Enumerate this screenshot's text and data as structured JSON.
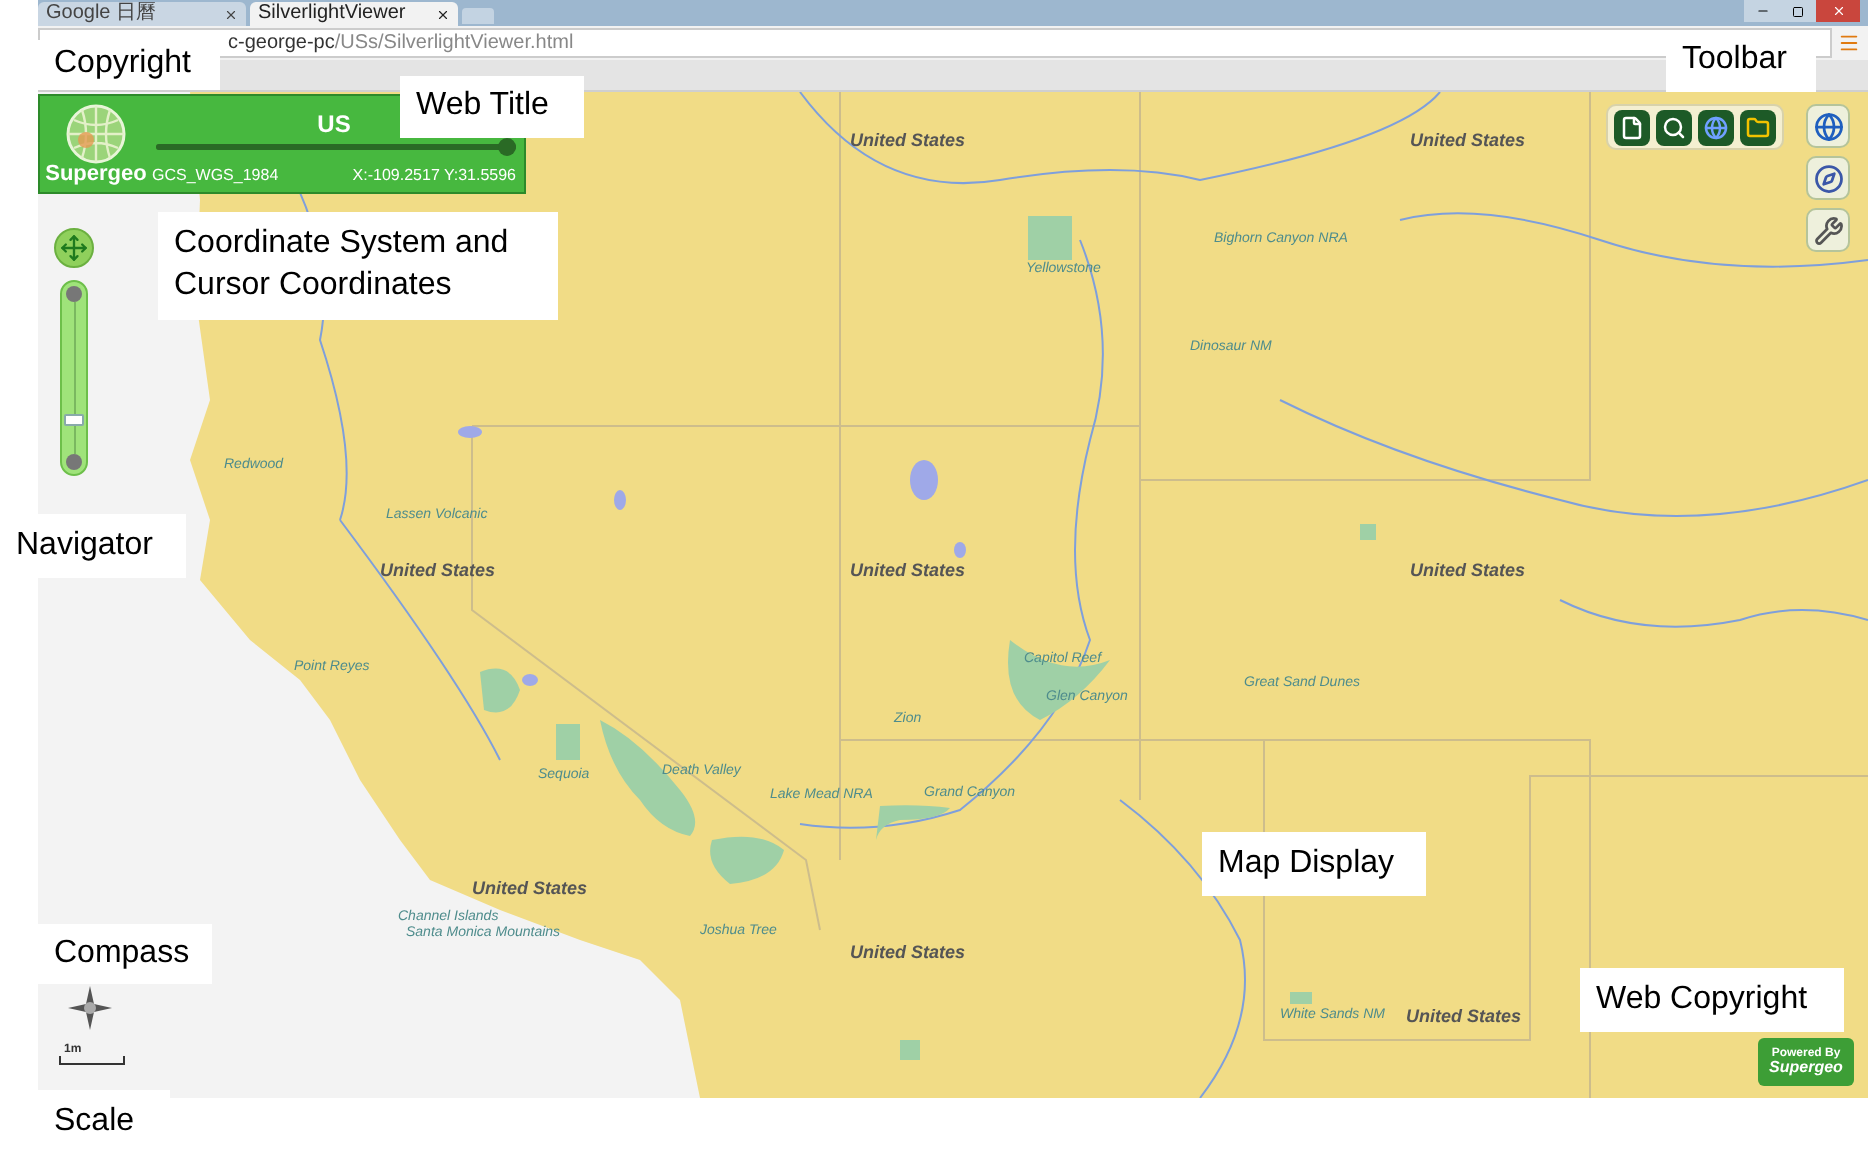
{
  "browser": {
    "tabs": [
      {
        "label": "Google 日曆",
        "selected": false
      },
      {
        "label": "SilverlightViewer",
        "selected": true
      }
    ],
    "address": {
      "host": "c-george-pc",
      "path": "/USs/SilverlightViewer.html"
    }
  },
  "title_panel": {
    "brand": "Supergeo",
    "title": "US",
    "coordinate_system": "GCS_WGS_1984",
    "cursor_coordinates": "X:-109.2517 Y:31.5596",
    "level": 1
  },
  "navigator": {
    "level": 0.2
  },
  "map_labels": [
    {
      "text": "United States",
      "kind": "region"
    },
    {
      "text": "United States",
      "kind": "region"
    },
    {
      "text": "United States",
      "kind": "region"
    },
    {
      "text": "United States",
      "kind": "region"
    },
    {
      "text": "United States",
      "kind": "region"
    },
    {
      "text": "United States",
      "kind": "region"
    },
    {
      "text": "United States",
      "kind": "region"
    },
    {
      "text": "United States",
      "kind": "region"
    },
    {
      "text": "Yellowstone",
      "kind": "park"
    },
    {
      "text": "Bighorn Canyon NRA",
      "kind": "park"
    },
    {
      "text": "Dinosaur NM",
      "kind": "park"
    },
    {
      "text": "Redwood",
      "kind": "park"
    },
    {
      "text": "Lassen Volcanic",
      "kind": "park"
    },
    {
      "text": "Point Reyes",
      "kind": "park"
    },
    {
      "text": "Capitol Reef",
      "kind": "park"
    },
    {
      "text": "Glen Canyon",
      "kind": "park"
    },
    {
      "text": "Great Sand Dunes",
      "kind": "park"
    },
    {
      "text": "Zion",
      "kind": "park"
    },
    {
      "text": "Sequoia",
      "kind": "park"
    },
    {
      "text": "Death Valley",
      "kind": "park"
    },
    {
      "text": "Lake Mead NRA",
      "kind": "park"
    },
    {
      "text": "Grand Canyon",
      "kind": "park"
    },
    {
      "text": "Channel Islands",
      "kind": "park"
    },
    {
      "text": "Santa Monica Mountains",
      "kind": "park"
    },
    {
      "text": "Joshua Tree",
      "kind": "park"
    },
    {
      "text": "White Sands NM",
      "kind": "park"
    }
  ],
  "scale": {
    "label": "1m"
  },
  "powered_by": {
    "line_1": "Powered By",
    "line_2": "Supergeo"
  },
  "annotations": [
    {
      "text": "Copyright"
    },
    {
      "text": "Web Title"
    },
    {
      "text": "Toolbar"
    },
    {
      "text": "Coordinate System and Cursor Coordinates"
    },
    {
      "text": "Navigator"
    },
    {
      "text": "Map Display"
    },
    {
      "text": "Compass"
    },
    {
      "text": "Web Copyright"
    },
    {
      "text": "Scale"
    }
  ]
}
